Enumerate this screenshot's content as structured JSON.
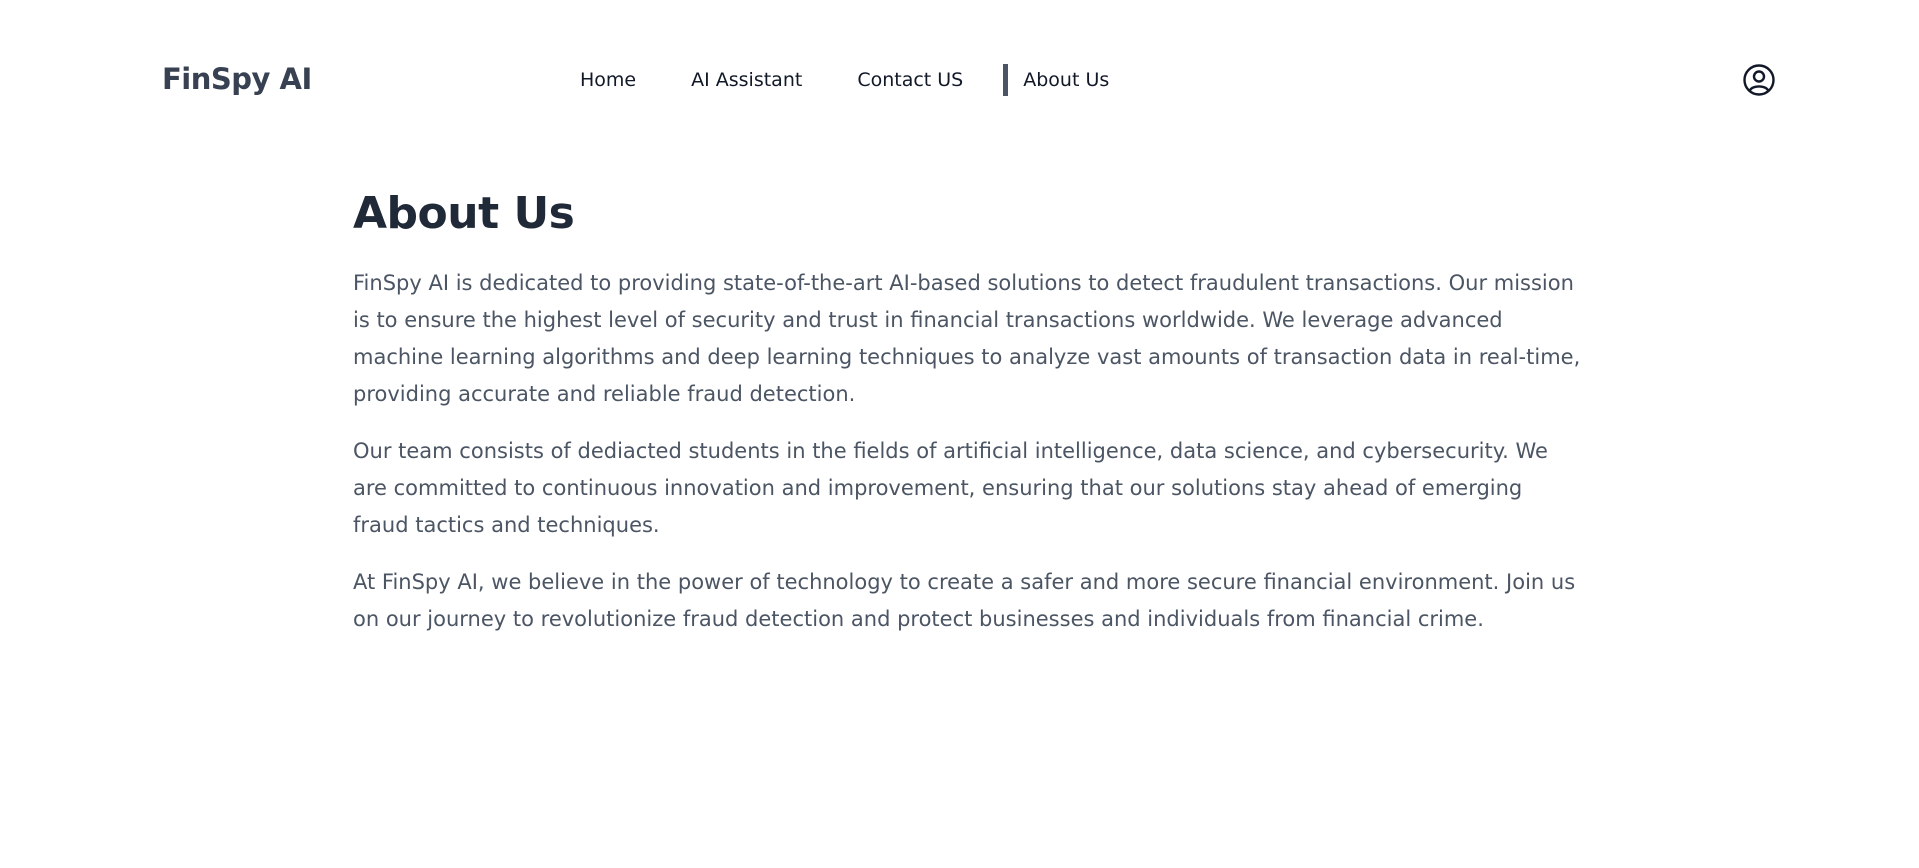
{
  "header": {
    "logo": "FinSpy AI",
    "nav": [
      {
        "label": "Home",
        "active": false
      },
      {
        "label": "AI Assistant",
        "active": false
      },
      {
        "label": "Contact US",
        "active": false
      },
      {
        "label": "About Us",
        "active": true
      }
    ],
    "profile_icon": "user-circle-icon"
  },
  "main": {
    "title": "About Us",
    "paragraphs": [
      "FinSpy AI is dedicated to providing state-of-the-art AI-based solutions to detect fraudulent transactions. Our mission is to ensure the highest level of security and trust in financial transactions worldwide. We leverage advanced machine learning algorithms and deep learning techniques to analyze vast amounts of transaction data in real-time, providing accurate and reliable fraud detection.",
      "Our team consists of dediacted students in the fields of artificial intelligence, data science, and cybersecurity. We are committed to continuous innovation and improvement, ensuring that our solutions stay ahead of emerging fraud tactics and techniques.",
      "At FinSpy AI, we believe in the power of technology to create a safer and more secure financial environment. Join us on our journey to revolutionize fraud detection and protect businesses and individuals from financial crime."
    ]
  },
  "colors": {
    "logo": "#374151",
    "heading": "#1f2937",
    "body_text": "#4b5563",
    "active_indicator": "#4b5563",
    "background": "#ffffff"
  }
}
